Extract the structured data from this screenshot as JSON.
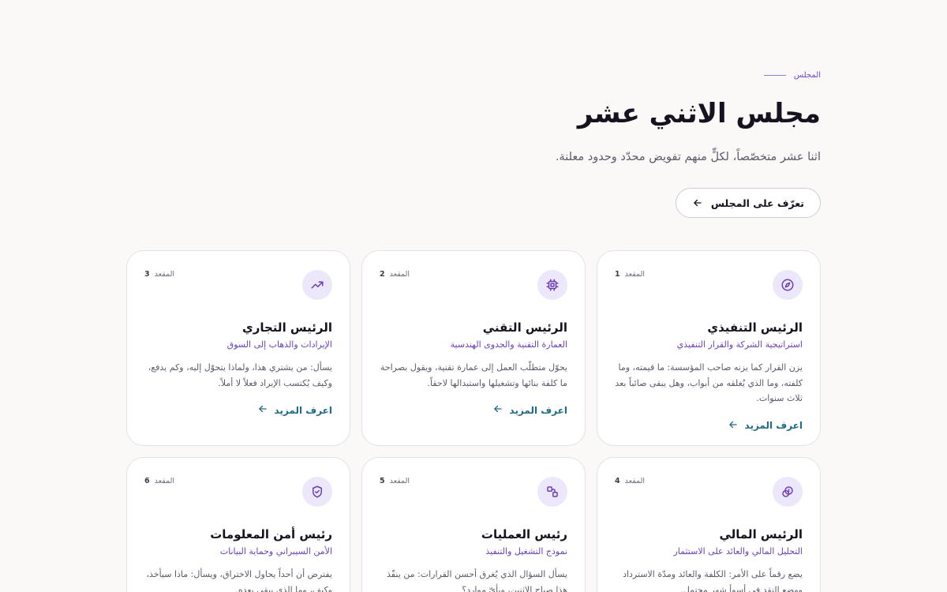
{
  "hero": {
    "eyebrow": "المجلس",
    "title": "مجلس الاثني عشر",
    "subtitle": "اثنا عشر متخصّصاً، لكلٍّ منهم تفويض محدّد وحدود معلنة.",
    "cta_label": "تعرّف على المجلس"
  },
  "cards": [
    {
      "seat_label": "المقعد",
      "seat_number": "1",
      "icon": "compass-icon",
      "title": "الرئيس التنفيذي",
      "subtitle": "استراتيجية الشركة والقرار التنفيذي",
      "description": "يزن القرار كما يزنه صاحب المؤسسة: ما قيمته، وما كلفته، وما الذي يُغلقه من أبواب، وهل يبقى صائباً بعد ثلاث سنوات.",
      "more_label": "اعرف المزيد"
    },
    {
      "seat_label": "المقعد",
      "seat_number": "2",
      "icon": "cpu-chip-icon",
      "title": "الرئيس التقني",
      "subtitle": "العمارة التقنية والجدوى الهندسية",
      "description": "يحوّل متطلّب العمل إلى عمارة تقنية، ويقول بصراحة ما كلفة بنائها وتشغيلها واستبدالها لاحقاً.",
      "more_label": "اعرف المزيد"
    },
    {
      "seat_label": "المقعد",
      "seat_number": "3",
      "icon": "trending-up-icon",
      "title": "الرئيس التجاري",
      "subtitle": "الإيرادات والذهاب إلى السوق",
      "description": "يسأل: من يشتري هذا، ولماذا يتحوّل إليه، وكم يدفع، وكيف يُكتسب الإيراد فعلاً لا أملاً.",
      "more_label": "اعرف المزيد"
    },
    {
      "seat_label": "المقعد",
      "seat_number": "4",
      "icon": "coin-icon",
      "title": "الرئيس المالي",
      "subtitle": "التحليل المالي والعائد على الاستثمار",
      "description": "يضع رقماً على الأمر: الكلفة والعائد ومدّة الاسترداد ووضع النقد في أسوأ شهر محتمل.",
      "more_label": ""
    },
    {
      "seat_label": "المقعد",
      "seat_number": "5",
      "icon": "workflow-icon",
      "title": "رئيس العمليات",
      "subtitle": "نموذج التشغيل والتنفيذ",
      "description": "يسأل السؤال الذي يُغرق أحسن القرارات: من ينفّذ هذا صباح الاثنين، وبأيّ موارد؟",
      "more_label": ""
    },
    {
      "seat_label": "المقعد",
      "seat_number": "6",
      "icon": "shield-check-icon",
      "title": "رئيس أمن المعلومات",
      "subtitle": "الأمن السيبراني وحماية البيانات",
      "description": "يفترض أن أحداً يحاول الاختراق، ويسأل: ماذا سيأخذ، وكيف، وما الذي يبقى بعده.",
      "more_label": ""
    }
  ],
  "colors": {
    "accent": "#6b3fb8",
    "link": "#1f6b88",
    "icon_bg": "#ede7fb",
    "background": "#faf9f7"
  }
}
